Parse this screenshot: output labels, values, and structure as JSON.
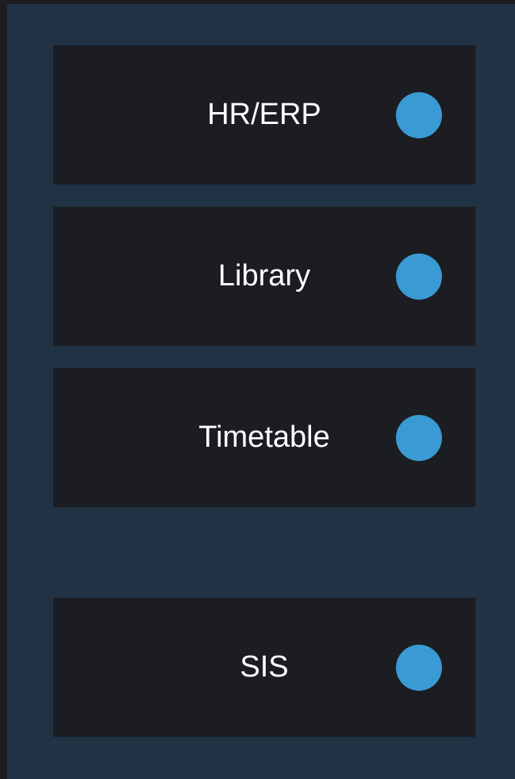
{
  "systems": [
    {
      "label": "HR/ERP",
      "status_color": "#3a9ad3"
    },
    {
      "label": "Library",
      "status_color": "#3a9ad3"
    },
    {
      "label": "Timetable",
      "status_color": "#3a9ad3"
    },
    {
      "label": "SIS",
      "status_color": "#3a9ad3"
    }
  ],
  "colors": {
    "page_background": "#1b1d22",
    "panel_background": "#203244",
    "box_background": "#1b1d22",
    "label_text": "#ffffff",
    "status_dot": "#3a9ad3"
  }
}
